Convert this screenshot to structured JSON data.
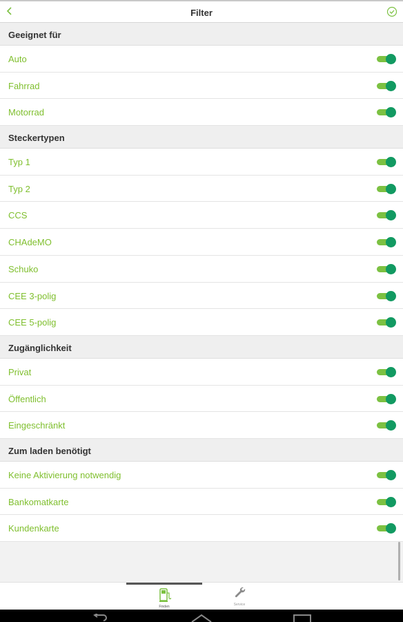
{
  "header": {
    "title": "Filter",
    "back_icon": "chevron-left-icon",
    "confirm_icon": "check-circle-icon",
    "accent_color": "#7cc142"
  },
  "sections": [
    {
      "title": "Geeignet für",
      "items": [
        {
          "label": "Auto",
          "enabled": true
        },
        {
          "label": "Fahrrad",
          "enabled": true
        },
        {
          "label": "Motorrad",
          "enabled": true
        }
      ]
    },
    {
      "title": "Steckertypen",
      "items": [
        {
          "label": "Typ 1",
          "enabled": true
        },
        {
          "label": "Typ 2",
          "enabled": true
        },
        {
          "label": "CCS",
          "enabled": true
        },
        {
          "label": "CHAdeMO",
          "enabled": true
        },
        {
          "label": "Schuko",
          "enabled": true
        },
        {
          "label": "CEE 3-polig",
          "enabled": true
        },
        {
          "label": "CEE 5-polig",
          "enabled": true
        }
      ]
    },
    {
      "title": "Zugänglichkeit",
      "items": [
        {
          "label": "Privat",
          "enabled": true
        },
        {
          "label": "Öffentlich",
          "enabled": true
        },
        {
          "label": "Eingeschränkt",
          "enabled": true
        }
      ]
    },
    {
      "title": "Zum laden benötigt",
      "items": [
        {
          "label": "Keine Aktivierung notwendig",
          "enabled": true
        },
        {
          "label": "Bankomatkarte",
          "enabled": true
        },
        {
          "label": "Kundenkarte",
          "enabled": true
        }
      ]
    }
  ],
  "tabbar": {
    "tabs": [
      {
        "label": "Finden",
        "icon": "charging-station-icon",
        "active": true
      },
      {
        "label": "Service",
        "icon": "wrench-icon",
        "active": false
      }
    ]
  },
  "system_nav": {
    "buttons": [
      "back-icon",
      "home-icon",
      "recents-icon"
    ]
  }
}
